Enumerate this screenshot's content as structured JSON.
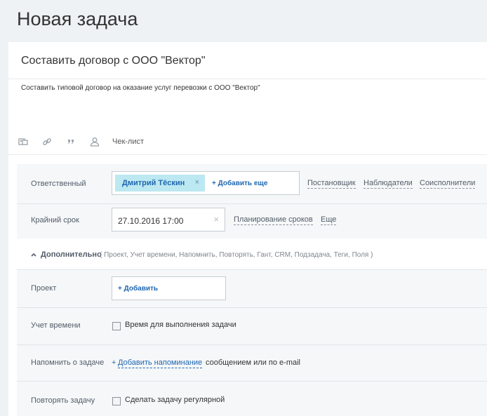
{
  "page": {
    "title": "Новая задача"
  },
  "task": {
    "title": "Составить договор с ООО \"Вектор\"",
    "description": "Составить типовой договор на оказание услуг перевозки с ООО \"Вектор\""
  },
  "toolbar": {
    "icons": [
      "camera-file-icon",
      "link-icon",
      "quote-icon",
      "user-icon"
    ],
    "checklist_label": "Чек-лист"
  },
  "responsible": {
    "label": "Ответственный",
    "person": "Дмитрий Тёскин",
    "remove_glyph": "×",
    "add_more": "+ Добавить еще",
    "links": [
      "Постановщик",
      "Наблюдатели",
      "Соисполнители"
    ]
  },
  "deadline": {
    "label": "Крайний срок",
    "value": "27.10.2016 17:00",
    "clear_glyph": "×",
    "links": [
      "Планирование сроков",
      "Еще"
    ]
  },
  "extra": {
    "title": "Дополнительно",
    "chevron": "^",
    "items_text": "( Проект,  Учет времени,  Напомнить,  Повторять,  Гант,  CRM,  Подзадача,  Теги,  Поля )"
  },
  "project": {
    "label": "Проект",
    "add": "+ Добавить"
  },
  "time_tracking": {
    "label": "Учет времени",
    "checkbox_label": "Время для выполнения задачи"
  },
  "reminder": {
    "label": "Напомнить о задаче",
    "plus": "+",
    "link": "Добавить напоминание",
    "rest": "сообщением или по e-mail"
  },
  "repeat": {
    "label": "Повторять задачу",
    "checkbox_label": "Сделать задачу регулярной"
  },
  "colors": {
    "accent": "#2067b0",
    "tag_bg": "#bce8f1",
    "page_bg": "#eef2f4"
  }
}
